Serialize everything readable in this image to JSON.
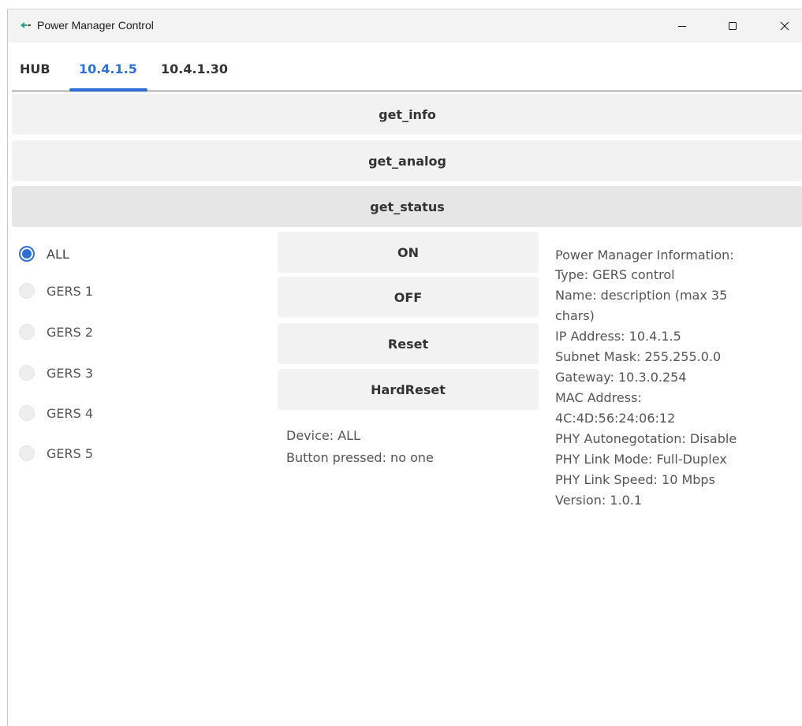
{
  "window": {
    "title": "Power Manager Control",
    "icon": "app-icon"
  },
  "tabs": [
    {
      "label": "HUB",
      "active": false
    },
    {
      "label": "10.4.1.5",
      "active": true
    },
    {
      "label": "10.4.1.30",
      "active": false
    }
  ],
  "actions": {
    "get_info": "get_info",
    "get_analog": "get_analog",
    "get_status": "get_status"
  },
  "devices": [
    {
      "label": "ALL",
      "selected": true
    },
    {
      "label": "GERS 1",
      "selected": false
    },
    {
      "label": "GERS 2",
      "selected": false
    },
    {
      "label": "GERS 3",
      "selected": false
    },
    {
      "label": "GERS 4",
      "selected": false
    },
    {
      "label": "GERS 5",
      "selected": false
    }
  ],
  "controls": {
    "on": "ON",
    "off": "OFF",
    "reset": "Reset",
    "hard_reset": "HardReset"
  },
  "status": {
    "device": "Device: ALL",
    "button": "Button pressed: no one"
  },
  "info": {
    "lines": [
      "Power Manager Information:",
      "Type: GERS control",
      "Name: description (max 35",
      "chars)",
      "IP Address: 10.4.1.5",
      "Subnet Mask: 255.255.0.0",
      "Gateway: 10.3.0.254",
      "MAC Address:",
      "4C:4D:56:24:06:12",
      "PHY Autonegotation: Disable",
      "PHY Link Mode: Full-Duplex",
      "PHY Link Speed: 10 Mbps",
      "Version: 1.0.1"
    ]
  },
  "colors": {
    "accent": "#2f6fd6",
    "button_bg": "#f2f2f2",
    "pressed_bg": "#e6e6e6"
  }
}
